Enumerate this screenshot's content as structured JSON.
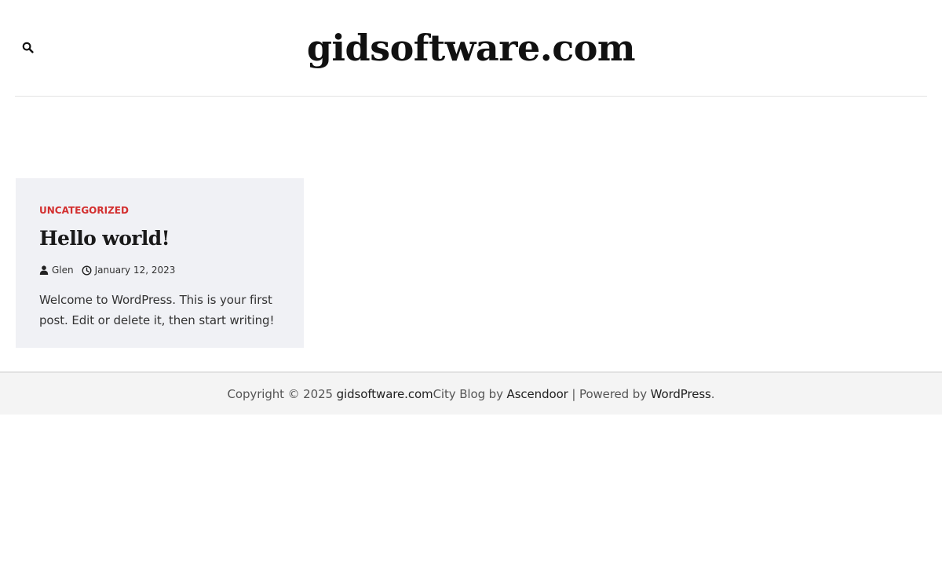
{
  "header": {
    "site_title": "gidsoftware.com",
    "search_icon": "search-icon"
  },
  "post": {
    "category": "UNCATEGORIZED",
    "title": "Hello world!",
    "author": "Glen",
    "author_icon": "user-icon",
    "date": "January 12, 2023",
    "date_icon": "clock-icon",
    "excerpt_line1": "Welcome to WordPress. This is your first",
    "excerpt_line2": "post. Edit or delete it, then start writing!"
  },
  "footer": {
    "copyright_prefix": "Copyright © 2025",
    "site_link": "gidsoftware.com",
    "theme_text": "City Blog by",
    "theme_author_link": "Ascendoor",
    "powered_by": "| Powered by",
    "wordpress_link": "WordPress",
    "end_period": "."
  },
  "colors": {
    "accent": "#d32f2f",
    "card_background": "#f0f1f5",
    "footer_background": "#f4f4f4"
  }
}
